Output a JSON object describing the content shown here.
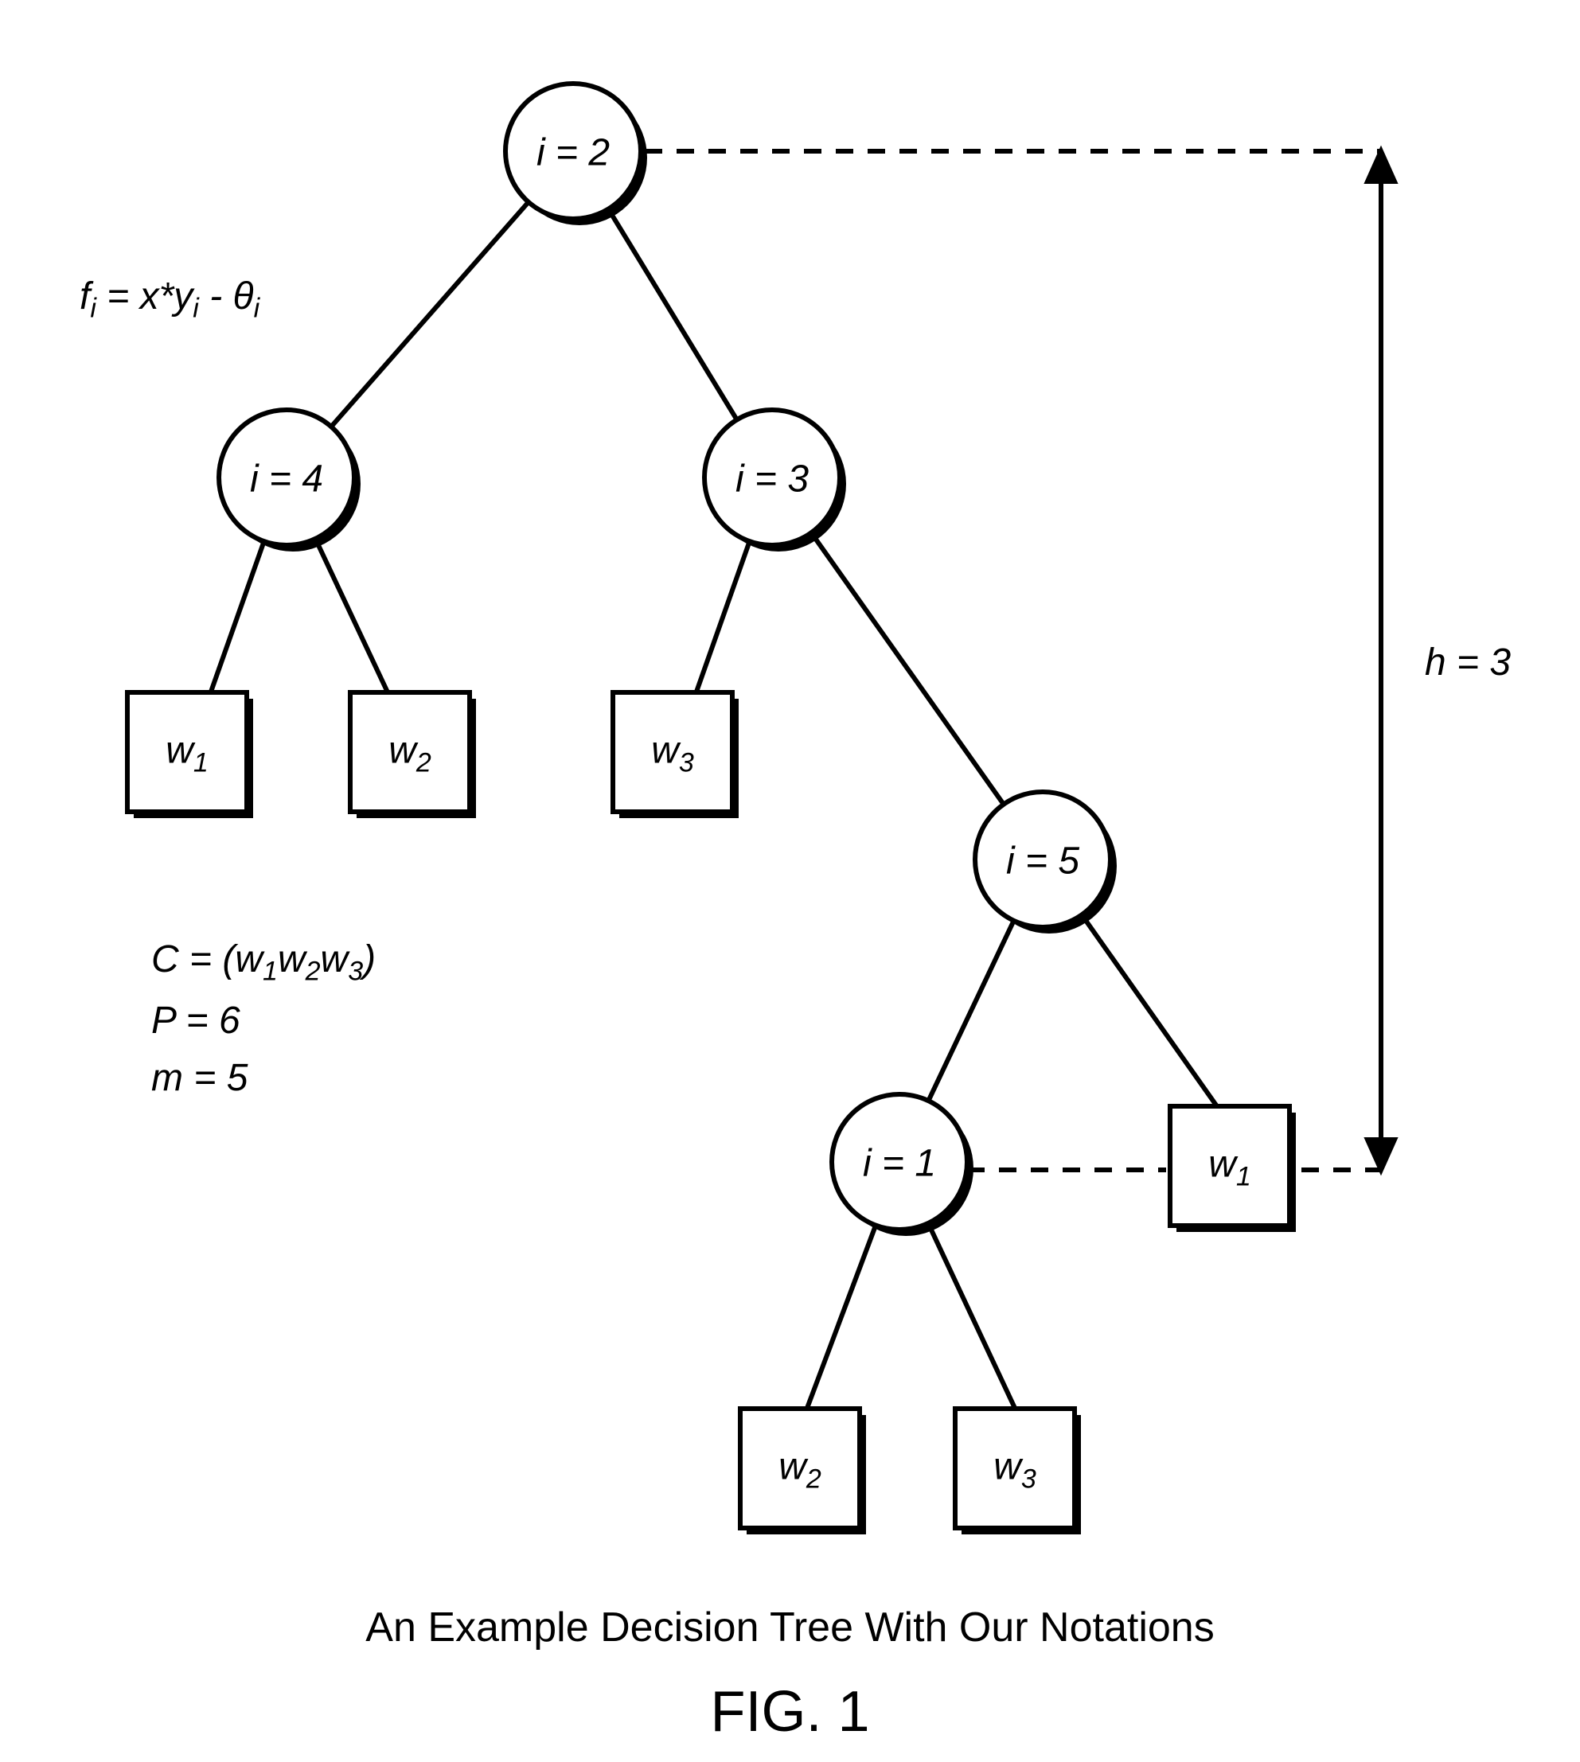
{
  "nodes": {
    "root": {
      "label": "i = 2"
    },
    "n4": {
      "label": "i = 4"
    },
    "n3": {
      "label": "i = 3"
    },
    "n5": {
      "label": "i = 5"
    },
    "n1": {
      "label": "i = 1"
    }
  },
  "leaves": {
    "w1a": {
      "body": "w",
      "sub": "1"
    },
    "w2a": {
      "body": "w",
      "sub": "2"
    },
    "w3a": {
      "body": "w",
      "sub": "3"
    },
    "w1b": {
      "body": "w",
      "sub": "1"
    },
    "w2b": {
      "body": "w",
      "sub": "2"
    },
    "w3b": {
      "body": "w",
      "sub": "3"
    }
  },
  "formula": {
    "prefix": "f",
    "sub1": "i",
    "mid": " = x*y",
    "sub2": "i",
    "mid2": " - θ",
    "sub3": "i"
  },
  "height_label": "h = 3",
  "notation": {
    "line1_pre": "C = (w",
    "line1_s1": "1",
    "line1_m1": "w",
    "line1_s2": "2",
    "line1_m2": "w",
    "line1_s3": "3",
    "line1_post": ")",
    "line2": "P = 6",
    "line3": "m = 5"
  },
  "caption": "An Example Decision Tree With Our Notations",
  "figure": "FIG. 1",
  "chart_data": {
    "type": "tree",
    "title": "An Example Decision Tree With Our Notations",
    "height": 3,
    "split_function": "f_i = x*y_i - theta_i",
    "class_set": [
      "w1",
      "w2",
      "w3"
    ],
    "P": 6,
    "m": 5,
    "root": {
      "id": "i=2",
      "kind": "internal",
      "children": [
        {
          "id": "i=4",
          "kind": "internal",
          "children": [
            {
              "id": "w1",
              "kind": "leaf"
            },
            {
              "id": "w2",
              "kind": "leaf"
            }
          ]
        },
        {
          "id": "i=3",
          "kind": "internal",
          "children": [
            {
              "id": "w3",
              "kind": "leaf"
            },
            {
              "id": "i=5",
              "kind": "internal",
              "children": [
                {
                  "id": "i=1",
                  "kind": "internal",
                  "children": [
                    {
                      "id": "w2",
                      "kind": "leaf"
                    },
                    {
                      "id": "w3",
                      "kind": "leaf"
                    }
                  ]
                },
                {
                  "id": "w1",
                  "kind": "leaf"
                }
              ]
            }
          ]
        }
      ]
    }
  }
}
